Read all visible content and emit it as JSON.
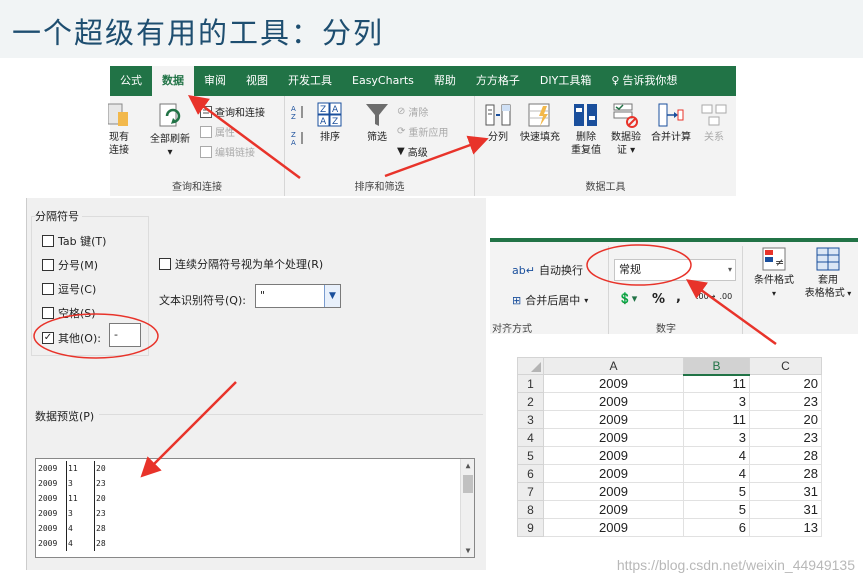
{
  "slide": {
    "title": "一个超级有用的工具：分列"
  },
  "ribbon": {
    "tabs": [
      {
        "label": "公式",
        "active": false
      },
      {
        "label": "数据",
        "active": true
      },
      {
        "label": "审阅",
        "active": false
      },
      {
        "label": "视图",
        "active": false
      },
      {
        "label": "开发工具",
        "active": false
      },
      {
        "label": "EasyCharts",
        "active": false
      },
      {
        "label": "帮助",
        "active": false
      },
      {
        "label": "方方格子",
        "active": false
      },
      {
        "label": "DIY工具箱",
        "active": false
      },
      {
        "label": "告诉我你想",
        "active": false
      }
    ],
    "query": {
      "existing_line1": "现有",
      "existing_line2": "连接",
      "refresh_all": "全部刷新",
      "queries_connections": "查询和连接",
      "properties": "属性",
      "edit_links": "编辑链接",
      "group_label": "查询和连接"
    },
    "sort_filter": {
      "sort": "排序",
      "filter": "筛选",
      "clear": "清除",
      "reapply": "重新应用",
      "advanced": "高级",
      "group_label": "排序和筛选"
    },
    "data_tools": {
      "text_to_columns": "分列",
      "flash_fill": "快速填充",
      "remove_dup_line1": "删除",
      "remove_dup_line2": "重复值",
      "validation_line1": "数据验",
      "validation_line2": "证",
      "consolidate": "合并计算",
      "relationships": "关系",
      "group_label": "数据工具"
    }
  },
  "dialog": {
    "delimiters_label": "分隔符号",
    "options": [
      {
        "label": "Tab 键(T)",
        "checked": false
      },
      {
        "label": "分号(M)",
        "checked": false
      },
      {
        "label": "逗号(C)",
        "checked": false
      },
      {
        "label": "空格(S)",
        "checked": false
      },
      {
        "label": "其他(O):",
        "checked": true
      }
    ],
    "other_value": "-",
    "consecutive_label": "连续分隔符号视为单个处理(R)",
    "qualifier_label": "文本识别符号(Q):",
    "qualifier_value": "\"",
    "preview_label": "数据预览(P)",
    "preview_rows": [
      [
        "2009",
        "11",
        "20"
      ],
      [
        "2009",
        "3",
        "23"
      ],
      [
        "2009",
        "11",
        "20"
      ],
      [
        "2009",
        "3",
        "23"
      ],
      [
        "2009",
        "4",
        "28"
      ],
      [
        "2009",
        "4",
        "28"
      ]
    ]
  },
  "home_ribbon": {
    "wrap_text": "自动换行",
    "merge_center": "合并后居中",
    "alignment_group": "对齐方式",
    "format_value": "常规",
    "number_group": "数字",
    "percent": "%",
    "comma": ",",
    "cond_format": "条件格式",
    "table_format_line1": "套用",
    "table_format_line2": "表格格式"
  },
  "sheet": {
    "columns": [
      "A",
      "B",
      "C"
    ],
    "rows": [
      {
        "n": "1",
        "a": "2009",
        "b": "11",
        "c": "20"
      },
      {
        "n": "2",
        "a": "2009",
        "b": "3",
        "c": "23"
      },
      {
        "n": "3",
        "a": "2009",
        "b": "11",
        "c": "20"
      },
      {
        "n": "4",
        "a": "2009",
        "b": "3",
        "c": "23"
      },
      {
        "n": "5",
        "a": "2009",
        "b": "4",
        "c": "28"
      },
      {
        "n": "6",
        "a": "2009",
        "b": "4",
        "c": "28"
      },
      {
        "n": "7",
        "a": "2009",
        "b": "5",
        "c": "31"
      },
      {
        "n": "8",
        "a": "2009",
        "b": "5",
        "c": "31"
      },
      {
        "n": "9",
        "a": "2009",
        "b": "6",
        "c": "13"
      }
    ]
  },
  "watermark": "https://blog.csdn.net/weixin_44949135",
  "colors": {
    "excel_green": "#217346",
    "annotation_red": "#e8332a",
    "title_blue": "#1e4e70"
  }
}
